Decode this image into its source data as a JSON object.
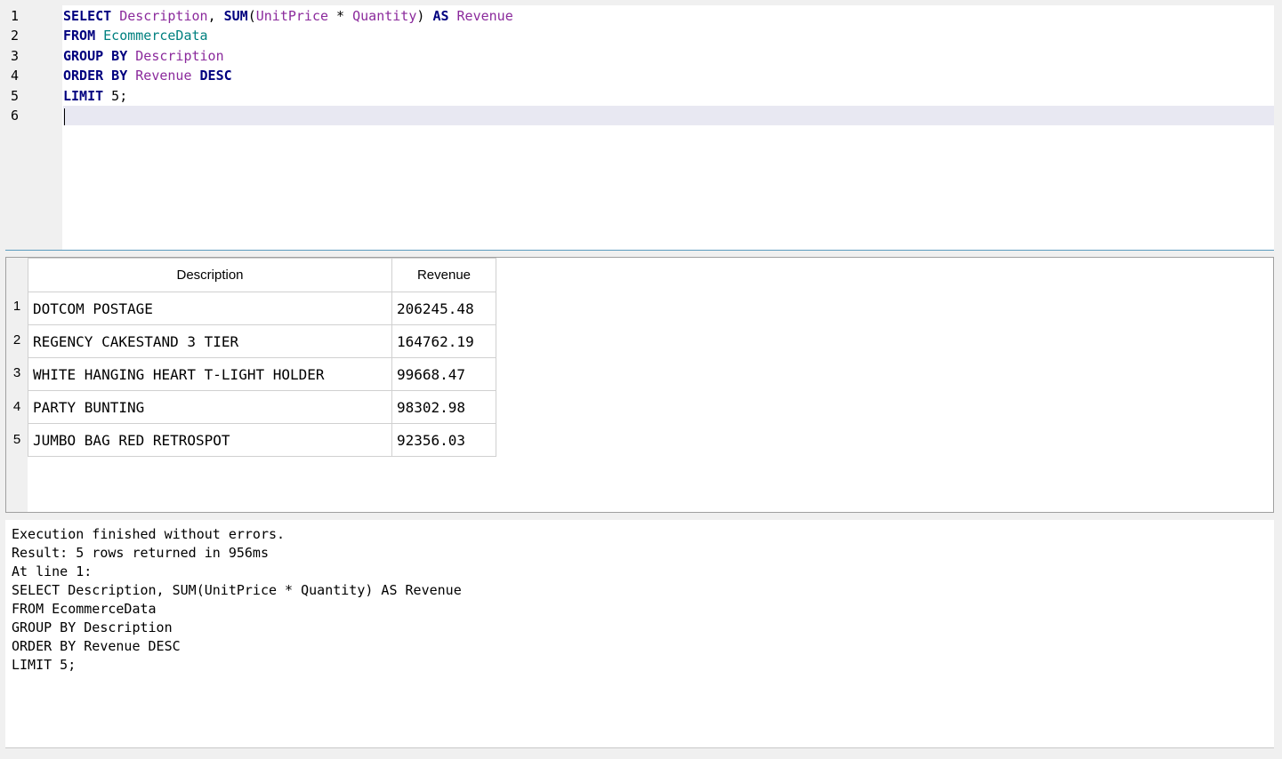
{
  "editor": {
    "line_numbers": [
      "1",
      "2",
      "3",
      "4",
      "5",
      "6"
    ],
    "lines": [
      [
        {
          "t": "SELECT",
          "c": "kw"
        },
        {
          "t": " ",
          "c": "op"
        },
        {
          "t": "Description",
          "c": "id"
        },
        {
          "t": ", ",
          "c": "op"
        },
        {
          "t": "SUM",
          "c": "kw"
        },
        {
          "t": "(",
          "c": "op"
        },
        {
          "t": "UnitPrice",
          "c": "id"
        },
        {
          "t": " * ",
          "c": "op"
        },
        {
          "t": "Quantity",
          "c": "id"
        },
        {
          "t": ") ",
          "c": "op"
        },
        {
          "t": "AS",
          "c": "kw"
        },
        {
          "t": " ",
          "c": "op"
        },
        {
          "t": "Revenue",
          "c": "id"
        }
      ],
      [
        {
          "t": "FROM",
          "c": "kw"
        },
        {
          "t": " ",
          "c": "op"
        },
        {
          "t": "EcommerceData",
          "c": "tbl"
        }
      ],
      [
        {
          "t": "GROUP BY",
          "c": "kw"
        },
        {
          "t": " ",
          "c": "op"
        },
        {
          "t": "Description",
          "c": "id"
        }
      ],
      [
        {
          "t": "ORDER BY",
          "c": "kw"
        },
        {
          "t": " ",
          "c": "op"
        },
        {
          "t": "Revenue",
          "c": "id"
        },
        {
          "t": " ",
          "c": "op"
        },
        {
          "t": "DESC",
          "c": "kw"
        }
      ],
      [
        {
          "t": "LIMIT",
          "c": "kw"
        },
        {
          "t": " 5;",
          "c": "op"
        }
      ],
      []
    ],
    "current_line": 6
  },
  "results": {
    "columns": [
      "Description",
      "Revenue"
    ],
    "rows": [
      {
        "num": "1",
        "description": "DOTCOM POSTAGE",
        "revenue": "206245.48"
      },
      {
        "num": "2",
        "description": "REGENCY CAKESTAND 3 TIER",
        "revenue": "164762.19"
      },
      {
        "num": "3",
        "description": "WHITE HANGING HEART T-LIGHT HOLDER",
        "revenue": "99668.47"
      },
      {
        "num": "4",
        "description": "PARTY BUNTING",
        "revenue": "98302.98"
      },
      {
        "num": "5",
        "description": "JUMBO BAG RED RETROSPOT",
        "revenue": "92356.03"
      }
    ]
  },
  "messages": {
    "lines": [
      "Execution finished without errors.",
      "Result: 5 rows returned in 956ms",
      "At line 1:",
      "SELECT Description, SUM(UnitPrice * Quantity) AS Revenue",
      "FROM EcommerceData",
      "GROUP BY Description",
      "ORDER BY Revenue DESC",
      "LIMIT 5;"
    ]
  }
}
